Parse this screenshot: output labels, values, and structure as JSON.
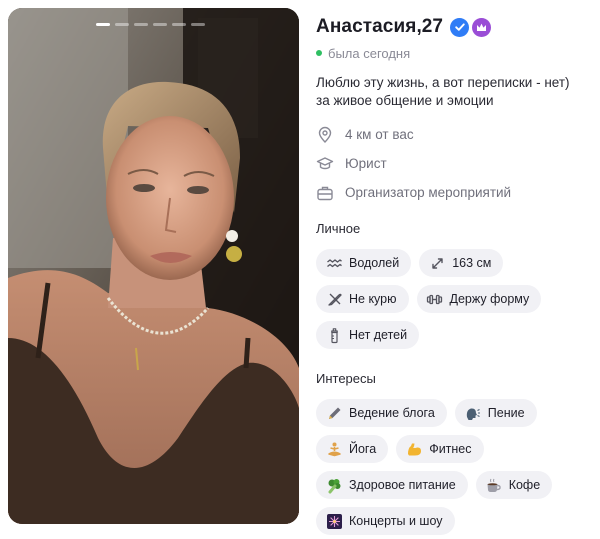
{
  "profile": {
    "name": "Анастасия",
    "age": "27",
    "name_separator": ", ",
    "status": "была сегодня",
    "bio_lines": [
      "Люблю эту жизнь, а вот переписки - нет)",
      "за живое общение и эмоции"
    ],
    "facts": [
      {
        "icon": "location-pin-icon",
        "text": "4 км от вас"
      },
      {
        "icon": "graduation-cap-icon",
        "text": "Юрист"
      },
      {
        "icon": "briefcase-icon",
        "text": "Организатор мероприятий"
      }
    ]
  },
  "photo": {
    "alt": "Profile photo",
    "count": 6,
    "active_index": 0
  },
  "personal": {
    "title": "Личное",
    "chips": [
      {
        "icon": "aquarius-icon",
        "label": "Водолей"
      },
      {
        "icon": "height-arrows-icon",
        "label": "163 см"
      },
      {
        "icon": "no-smoking-icon",
        "label": "Не курю"
      },
      {
        "icon": "dumbbell-icon",
        "label": "Держу форму"
      },
      {
        "icon": "baby-bottle-icon",
        "label": "Нет детей"
      }
    ]
  },
  "interests": {
    "title": "Интересы",
    "chips": [
      {
        "icon": "pen-icon",
        "emoji": "🖊️",
        "label": "Ведение блога"
      },
      {
        "icon": "singing-head-icon",
        "emoji": "🗣️",
        "label": "Пение"
      },
      {
        "icon": "yoga-icon",
        "emoji": "🧘",
        "label": "Йога"
      },
      {
        "icon": "flexed-bicep-icon",
        "emoji": "💪",
        "label": "Фитнес"
      },
      {
        "icon": "broccoli-icon",
        "emoji": "🥦",
        "label": "Здоровое питание"
      },
      {
        "icon": "coffee-icon",
        "emoji": "☕",
        "label": "Кофе"
      },
      {
        "icon": "fireworks-icon",
        "emoji": "🎆",
        "label": "Концерты и шоу"
      }
    ]
  },
  "colors": {
    "verified": "#2f7cf6",
    "premium": "#9a4dd6",
    "online": "#2fbf62",
    "chip_bg": "#f1f1f5"
  }
}
